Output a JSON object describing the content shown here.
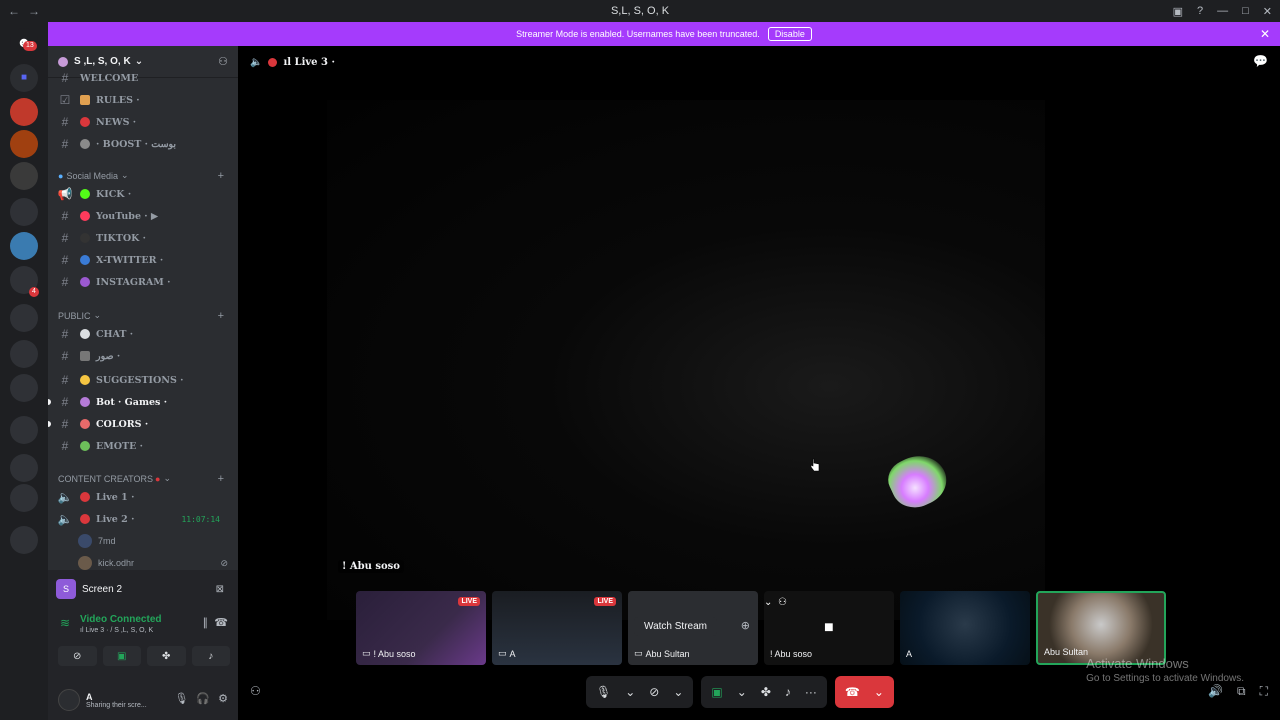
{
  "titlebar": {
    "title": "S,L, S, O, K"
  },
  "banner": {
    "text": "Streamer Mode is enabled. Usernames have been truncated.",
    "button": "Disable"
  },
  "rail": {
    "dm_badge": "13",
    "guild_badge": "4"
  },
  "server": {
    "name": "S ,L, S, O, K"
  },
  "channels": [
    {
      "label": "WELCOME",
      "prefix": "ıl",
      "unread": false
    },
    {
      "label": "RULES ·",
      "prefix": "",
      "unread": false
    },
    {
      "label": "NEWS ·",
      "prefix": "ıl",
      "unread": false
    },
    {
      "label": "· BOOST · بوست",
      "prefix": "",
      "unread": false
    }
  ],
  "categories": {
    "social": "Social Media",
    "public": "PUBLIC",
    "creators": "CONTENT CREATORS"
  },
  "social_channels": [
    {
      "label": "KICK ·",
      "prefix": "ıl",
      "color": "#53fc18"
    },
    {
      "label": "YouTube · ▶",
      "prefix": "ıl",
      "color": "#ff3b5c"
    },
    {
      "label": "TIKTOK ·",
      "prefix": "ıl",
      "color": "#333333"
    },
    {
      "label": "X-TWITTER ·",
      "prefix": "ıl",
      "color": "#3a7bd5"
    },
    {
      "label": "INSTAGRAM ·",
      "prefix": "ıl",
      "color": "#9b59d0"
    }
  ],
  "public_channels": [
    {
      "label": "CHAT ·",
      "prefix": "ıl",
      "unread": false
    },
    {
      "label": "صور ·",
      "prefix": "ıl",
      "unread": false
    },
    {
      "label": "SUGGESTIONS ·",
      "prefix": "ıl",
      "unread": false
    },
    {
      "label": "Bot · Games ·",
      "prefix": "ıl",
      "unread": true
    },
    {
      "label": "COLORS ·",
      "prefix": "ıl",
      "unread": true
    },
    {
      "label": "EMOTE ·",
      "prefix": "ıl",
      "unread": false
    }
  ],
  "creator_channels": [
    {
      "label": "Live 1 ·",
      "prefix": "ıl"
    },
    {
      "label": "Live 2 ·",
      "prefix": "ıl",
      "timer": "11:07:14"
    }
  ],
  "voice_users": [
    "7md",
    "kick.odhr"
  ],
  "screen_panel": {
    "label": "Screen 2"
  },
  "voice_status": {
    "title": "Video Connected",
    "sub": "ıl Live 3 · / S ,L, S, O, K"
  },
  "user": {
    "name": "A",
    "status": "Sharing their scre..."
  },
  "stage": {
    "channel": "ıl Live 3 ·",
    "main_label": "! Abu soso"
  },
  "tiles": [
    {
      "label": "! Abu soso",
      "live": "LIVE"
    },
    {
      "label": "A",
      "live": "LIVE"
    },
    {
      "label": "Abu Sultan",
      "watch": "Watch Stream"
    },
    {
      "label": "! Abu soso"
    },
    {
      "label": "A"
    },
    {
      "label": "Abu Sultan"
    }
  ],
  "activate": {
    "title": "Activate Windows",
    "sub": "Go to Settings to activate Windows."
  }
}
